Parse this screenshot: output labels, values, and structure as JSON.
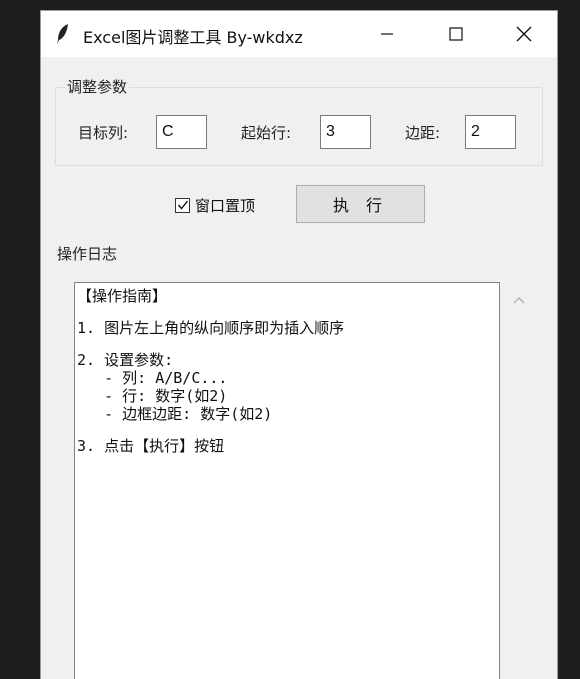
{
  "window": {
    "title": "Excel图片调整工具 By-wkdxz",
    "icons": {
      "app": "feather-icon",
      "minimize": "minimize-icon",
      "maximize": "maximize-icon",
      "close": "close-icon"
    }
  },
  "params": {
    "group_label": "调整参数",
    "target_column": {
      "label": "目标列:",
      "value": "C"
    },
    "start_row": {
      "label": "起始行:",
      "value": "3"
    },
    "margin": {
      "label": "边距:",
      "value": "2"
    }
  },
  "controls": {
    "topmost_label": "窗口置顶",
    "topmost_checked": true,
    "execute_label": "执 行"
  },
  "log": {
    "group_label": "操作日志",
    "lines": [
      "【操作指南】",
      "",
      "1. 图片左上角的纵向顺序即为插入顺序",
      "",
      "2. 设置参数:",
      "   - 列: A/B/C...",
      "   - 行: 数字(如2)",
      "   - 边框边距: 数字(如2)",
      "",
      "3. 点击【执行】按钮"
    ]
  },
  "colors": {
    "window_bg": "#f0f0f0",
    "desktop_bg": "#1e1e1e",
    "button_bg": "#e1e1e1"
  }
}
